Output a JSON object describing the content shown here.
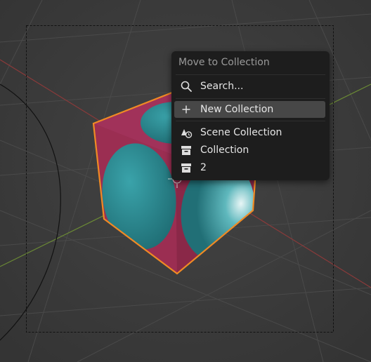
{
  "menu": {
    "title": "Move to Collection",
    "items": [
      {
        "label": "Search...",
        "icon": "search-icon"
      },
      {
        "label": "New Collection",
        "icon": "plus-icon",
        "highlighted": true
      },
      {
        "label": "Scene Collection",
        "icon": "scene-collection-icon"
      },
      {
        "label": "Collection",
        "icon": "collection-icon"
      },
      {
        "label": "2",
        "icon": "collection-icon"
      }
    ]
  },
  "colors": {
    "viewport_bg": "#3a3a3a",
    "menu_bg": "#1d1d1d",
    "highlight": "#474747",
    "selection_outline": "#f08a24",
    "cube_face": "#9a2c4f",
    "sphere": "#2f8b92"
  }
}
